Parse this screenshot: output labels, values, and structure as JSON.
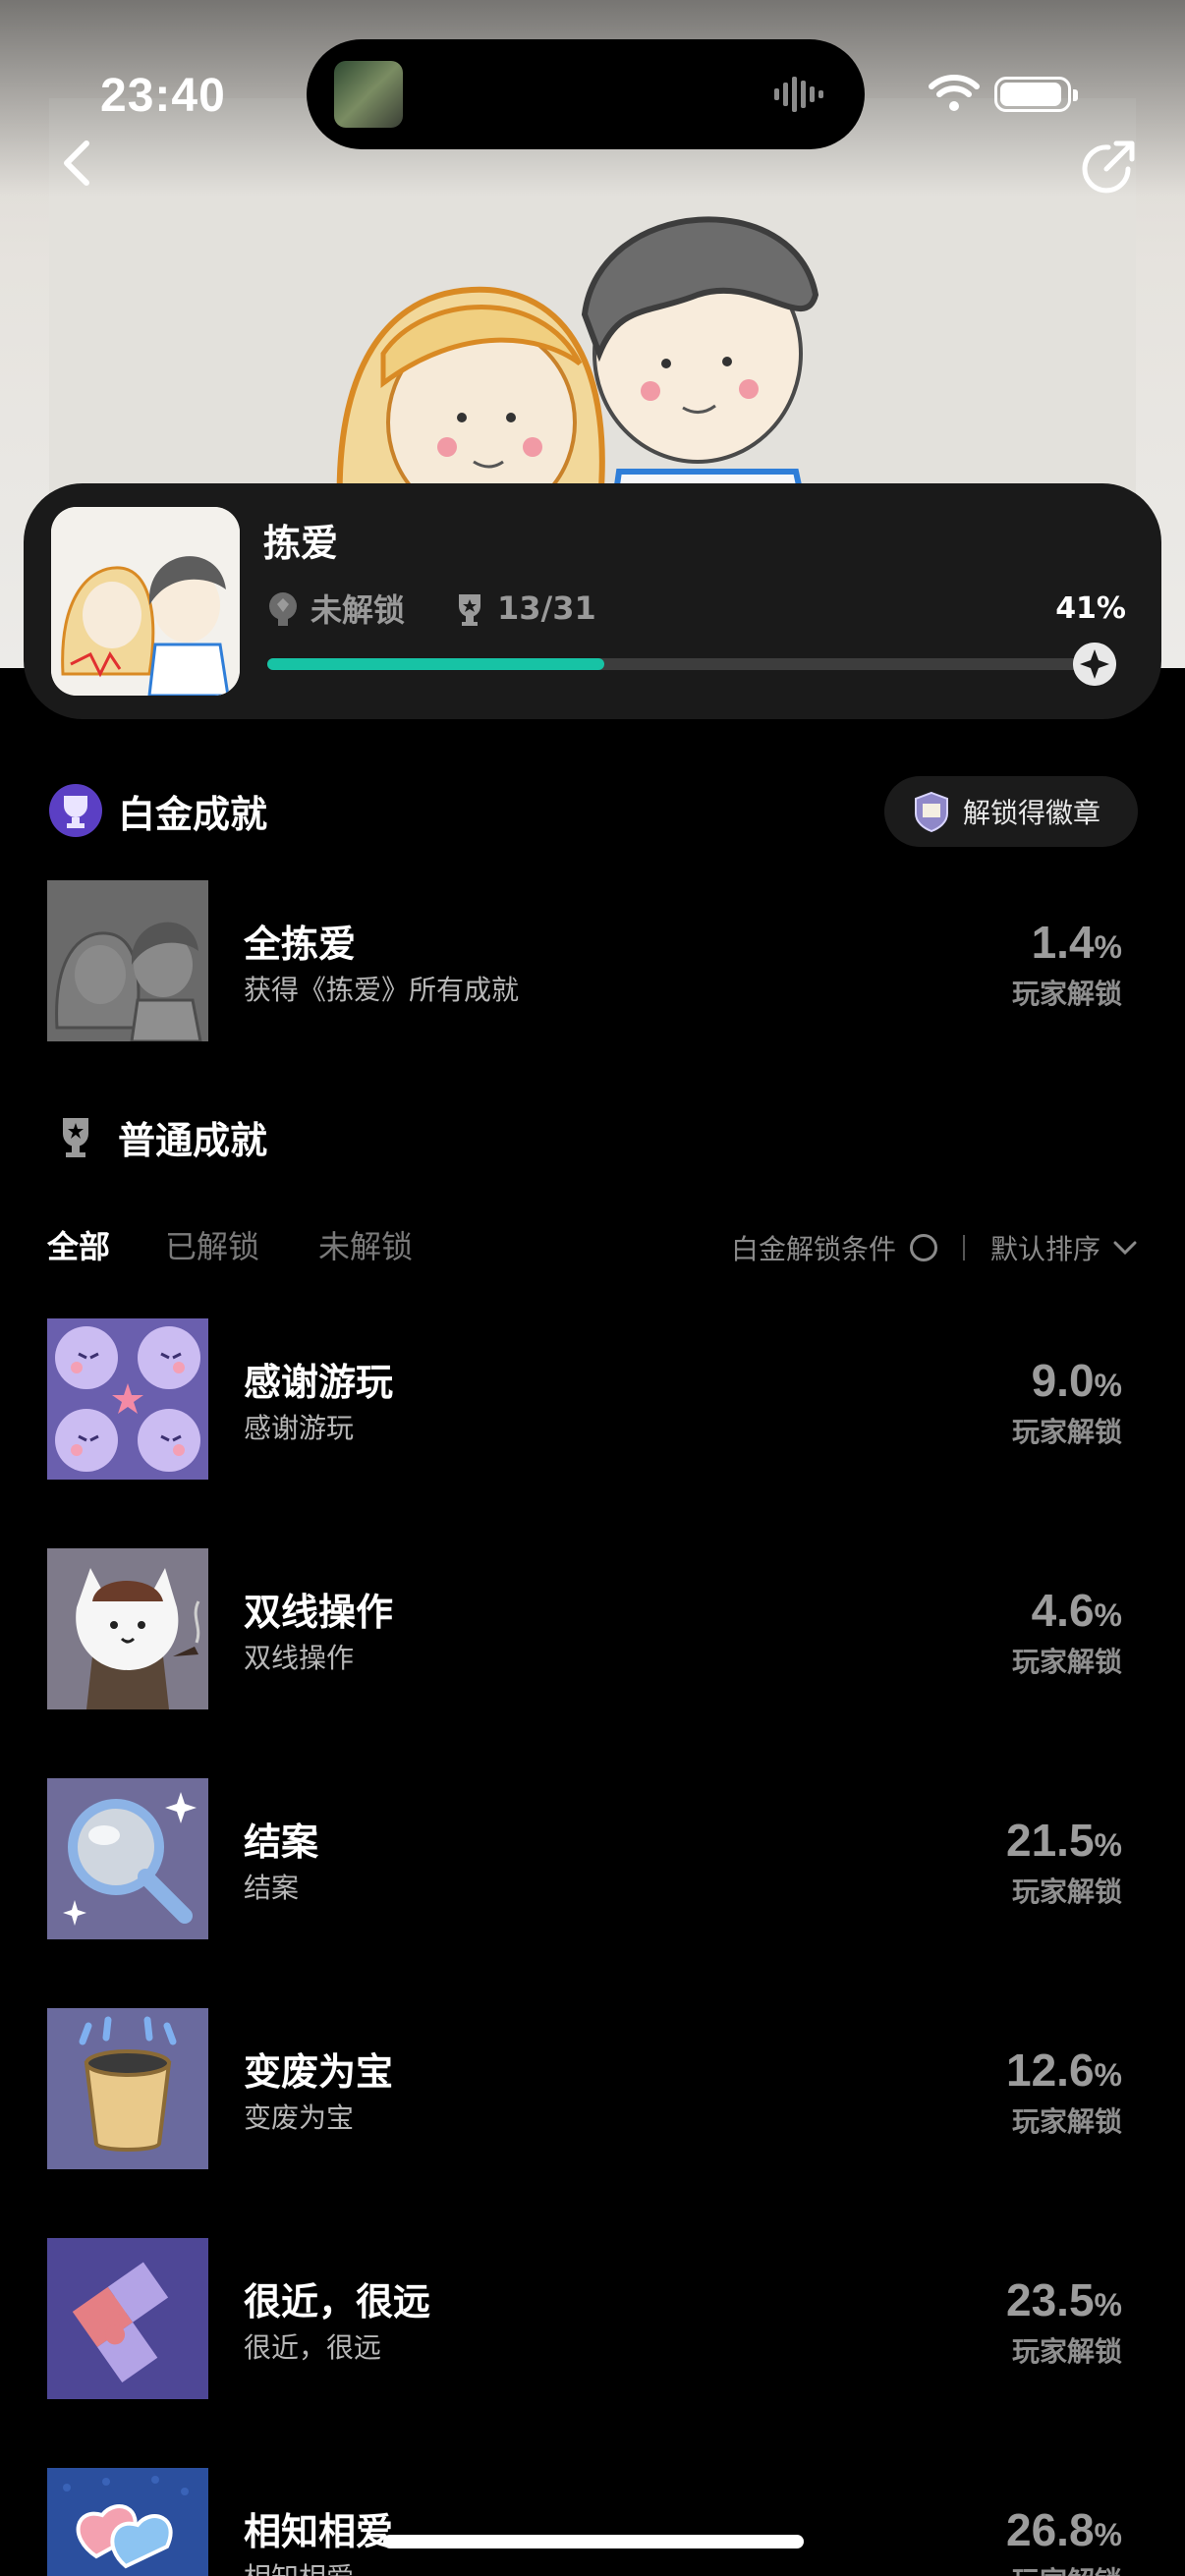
{
  "status_bar": {
    "time": "23:40"
  },
  "game": {
    "title": "拣爱",
    "lock_status": "未解锁",
    "trophy_count": "13/31",
    "progress_label": "41%",
    "progress": 0.41
  },
  "platinum": {
    "heading": "白金成就",
    "badge_button": "解锁得徽章",
    "item": {
      "title": "全拣爱",
      "desc": "获得《拣爱》所有成就",
      "pct": "1.4",
      "pct_unit": "%",
      "pct_label": "玩家解锁"
    }
  },
  "normal": {
    "heading": "普通成就",
    "tabs": [
      "全部",
      "已解锁",
      "未解锁"
    ],
    "filter_condition": "白金解锁条件",
    "sort_label": "默认排序",
    "items": [
      {
        "title": "感谢游玩",
        "desc": "感谢游玩",
        "pct": "9.0",
        "pct_unit": "%",
        "pct_label": "玩家解锁",
        "icon": "thanks-icon"
      },
      {
        "title": "双线操作",
        "desc": "双线操作",
        "pct": "4.6",
        "pct_unit": "%",
        "pct_label": "玩家解锁",
        "icon": "detective-cat-icon"
      },
      {
        "title": "结案",
        "desc": "结案",
        "pct": "21.5",
        "pct_unit": "%",
        "pct_label": "玩家解锁",
        "icon": "magnifier-icon"
      },
      {
        "title": "变废为宝",
        "desc": "变废为宝",
        "pct": "12.6",
        "pct_unit": "%",
        "pct_label": "玩家解锁",
        "icon": "cup-icon"
      },
      {
        "title": "很近，很远",
        "desc": "很近，很远",
        "pct": "23.5",
        "pct_unit": "%",
        "pct_label": "玩家解锁",
        "icon": "puzzle-icon"
      },
      {
        "title": "相知相爱",
        "desc": "相知相爱",
        "pct": "26.8",
        "pct_unit": "%",
        "pct_label": "玩家解锁",
        "icon": "hearts-icon"
      }
    ]
  },
  "colors": {
    "accent": "#17c3a5",
    "background": "#000000",
    "card": "#1a1a1a"
  }
}
